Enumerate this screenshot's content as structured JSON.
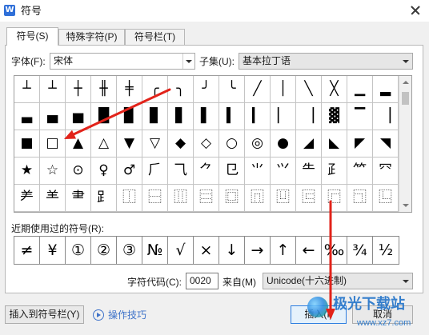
{
  "window": {
    "title": "符号",
    "logo_letter": "W"
  },
  "icons": {
    "app_logo": "wps-logo-icon",
    "close": "close-icon",
    "dropdown": "chevron-down-icon",
    "scroll_up": "chevron-up-icon",
    "scroll_down": "chevron-down-icon",
    "tips": "play-circle-icon",
    "watermark_logo": "watermark-logo-icon"
  },
  "tabs": [
    {
      "label": "符号(S)",
      "active": true
    },
    {
      "label": "特殊字符(P)",
      "active": false
    },
    {
      "label": "符号栏(T)",
      "active": false
    }
  ],
  "font": {
    "label": "字体(F):",
    "value": "宋体"
  },
  "subset": {
    "label": "子集(U):",
    "value": "基本拉丁语"
  },
  "symbol_grid": {
    "rows": [
      [
        "┴",
        "┴",
        "┼",
        "╫",
        "╪",
        "╭",
        "╮",
        "╯",
        "╰",
        "╱",
        "│",
        "╲",
        "╳",
        "▁",
        "▂"
      ],
      [
        "▃",
        "▄",
        "▅",
        "█",
        "▉",
        "▊",
        "▋",
        "▌",
        "▍",
        "▎",
        "▏",
        "▕",
        "▓",
        "▔",
        "▕"
      ],
      [
        "■",
        "□",
        "▲",
        "△",
        "▼",
        "▽",
        "◆",
        "◇",
        "○",
        "◎",
        "●",
        "◢",
        "◣",
        "◤",
        "◥"
      ],
      [
        "★",
        "☆",
        "⊙",
        "♀",
        "♂",
        "⺁",
        "⺄",
        "⺈",
        "⺋",
        "⺌",
        "⺍",
        "⺧",
        "⺪",
        "⺮",
        "⺳"
      ],
      [
        "⺶",
        "⺷",
        "⺻",
        "⻊",
        "⿰",
        "⿱",
        "⿲",
        "⿳",
        "⿴",
        "⿵",
        "⿶",
        "⿷",
        "⿸",
        "⿹",
        "⿺"
      ]
    ]
  },
  "recent": {
    "label": "近期使用过的符号(R):",
    "symbols": [
      "≠",
      "¥",
      "①",
      "②",
      "③",
      "№",
      "√",
      "×",
      "↓",
      "→",
      "↑",
      "←",
      "‰",
      "¾",
      "½"
    ]
  },
  "char_code": {
    "label": "字符代码(C):",
    "value": "0020"
  },
  "source": {
    "label": "来自(M)",
    "value": "Unicode(十六进制)"
  },
  "buttons": {
    "insert_to_bar": "插入到符号栏(Y)",
    "tips": "操作技巧",
    "insert": "插入(I)",
    "cancel": "取消"
  },
  "watermark": {
    "text": "极光下载站",
    "url": "www.xz7.com"
  },
  "colors": {
    "accent": "#2f6fd8",
    "link": "#3f73c9",
    "focus_border": "#2b7de0",
    "annotation_arrow": "#e2231a"
  }
}
